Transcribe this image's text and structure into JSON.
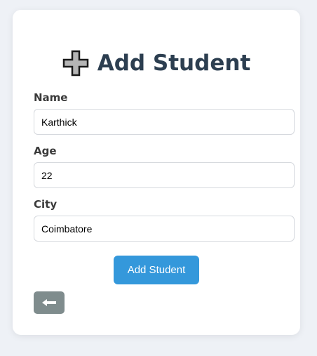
{
  "form": {
    "title": "Add Student",
    "title_icon": "heavy-plus-icon",
    "fields": [
      {
        "label": "Name",
        "value": "Karthick"
      },
      {
        "label": "Age",
        "value": "22"
      },
      {
        "label": "City",
        "value": "Coimbatore"
      }
    ],
    "submit_label": "Add Student",
    "back_icon": "left-arrow-icon"
  },
  "colors": {
    "primary_button": "#3498db",
    "back_button": "#7f8c8d",
    "title": "#2c3e50",
    "page_background": "#eef1f6"
  }
}
